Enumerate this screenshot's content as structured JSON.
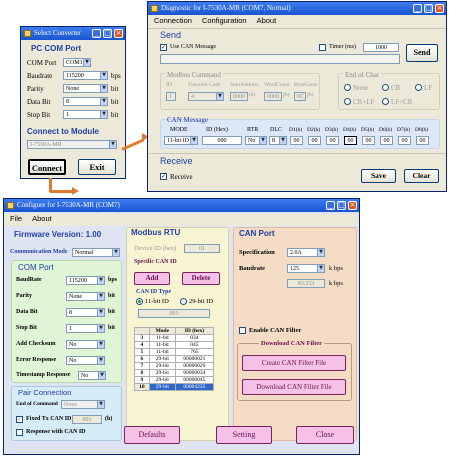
{
  "select": {
    "title": "Select Converter",
    "section1": "PC COM Port",
    "rows": [
      {
        "label": "COM Port",
        "value": "COM1",
        "unit": ""
      },
      {
        "label": "Baudrate",
        "value": "115200",
        "unit": "bps"
      },
      {
        "label": "Parity",
        "value": "None",
        "unit": "bit"
      },
      {
        "label": "Data Bit",
        "value": "8",
        "unit": "bit"
      },
      {
        "label": "Stop Bit",
        "value": "1",
        "unit": "bit"
      }
    ],
    "section2": "Connect to Module",
    "module": "I-7530A-MR",
    "connect": "Connect",
    "exit": "Exit"
  },
  "diag": {
    "title": "Diagnostic for I-7530A-MR (COM7, Normal)",
    "menu": [
      "Connection",
      "Configuration",
      "About"
    ],
    "send_title": "Send",
    "use_can": "Use CAN Message",
    "timer": "Timer (ms)",
    "timer_value": "1000",
    "send_btn": "Send",
    "modbus_title": "Modbus Command",
    "modbus_headers": [
      "ID",
      "Function Code",
      "StartAddress",
      "WordCount",
      "ByteCount"
    ],
    "modbus_values": [
      "1",
      "4",
      "0000",
      "0000",
      "0C"
    ],
    "hex": "(h)",
    "eoc_title": "End of Char",
    "eoc_opts": [
      "None",
      "CR",
      "LF",
      "CR+LF",
      "LF+CR"
    ],
    "canmsg_title": "CAN Message",
    "can_headers": [
      "MODE",
      "ID (Hex)",
      "RTR",
      "DLC",
      "D1(h)",
      "D2(h)",
      "D3(h)",
      "D4(h)",
      "D5(h)",
      "D6(h)",
      "D7(h)",
      "D8(h)"
    ],
    "can_mode": "11-bit ID",
    "can_id": "000",
    "can_rtr": "No",
    "can_dlc": "8",
    "can_data": [
      "00",
      "00",
      "00",
      "00",
      "00",
      "00",
      "00",
      "00"
    ],
    "receive_title": "Receive",
    "receive_chk": "Receive",
    "save": "Save",
    "clear": "Clear"
  },
  "cfg": {
    "title": "Configure for I-7530A-MR (COM7)",
    "menu": [
      "File",
      "About"
    ],
    "fw": "Firmware Version: 1.00",
    "comm_mode_label": "Communication Mode",
    "comm_mode": "Normal",
    "com_title": "COM Port",
    "com_rows": [
      {
        "label": "BaudRate",
        "value": "115200",
        "unit": "bps"
      },
      {
        "label": "Parity",
        "value": "None",
        "unit": "bit"
      },
      {
        "label": "Data Bit",
        "value": "8",
        "unit": "bit"
      },
      {
        "label": "Stop Bit",
        "value": "1",
        "unit": "bit"
      },
      {
        "label": "Add Checksum",
        "value": "No",
        "unit": ""
      },
      {
        "label": "Error Response",
        "value": "No",
        "unit": ""
      },
      {
        "label": "Timestamp Response",
        "value": "No",
        "unit": ""
      }
    ],
    "pair_title": "Pair Connection",
    "eoc_label": "End of Command",
    "eoc_value": "None",
    "fixed_tx": "Fixed Tx CAN ID",
    "fixed_tx_value": "001",
    "hex": "(h)",
    "resp_can": "Response with CAN ID",
    "modbus_title": "Modbus RTU",
    "device_id_label": "Device ID (hex)",
    "device_id": "01",
    "specific_title": "Specific CAN ID",
    "add": "Add",
    "delete": "Delete",
    "canid_type": "CAN ID Type",
    "opt_11": "11-bit ID",
    "opt_29": "29-bit ID",
    "canid_value": "001",
    "tbl_headers": [
      "Mode",
      "ID (hex)"
    ],
    "tbl_rows": [
      {
        "n": "3",
        "mode": "11-bit",
        "id": "034"
      },
      {
        "n": "4",
        "mode": "11-bit",
        "id": "045"
      },
      {
        "n": "5",
        "mode": "11-bit",
        "id": "765"
      },
      {
        "n": "6",
        "mode": "29-bit",
        "id": "00000021"
      },
      {
        "n": "7",
        "mode": "29-bit",
        "id": "00000029"
      },
      {
        "n": "8",
        "mode": "29-bit",
        "id": "00000034"
      },
      {
        "n": "9",
        "mode": "29-bit",
        "id": "00000045"
      },
      {
        "n": "10",
        "mode": "29-bit",
        "id": "00004235"
      }
    ],
    "canport_title": "CAN Port",
    "spec_label": "Specification",
    "spec_value": "2.0A",
    "baud_label": "Baudrate",
    "baud_value": "125",
    "kbps": "k bps",
    "baud_custom": "83.333",
    "enable_filter": "Enable CAN Filter",
    "dl_title": "Download CAN Filter",
    "create_filter": "Create CAN Filter File",
    "download_filter": "Download CAN Filter File",
    "defaults": "Defaults",
    "setting": "Setting",
    "close": "Close"
  },
  "colors": {
    "titlebar": "#2a5fd8",
    "heading": "#1f3fa8",
    "com_bg": "#dff5d6",
    "pair_bg": "#d6ecf7",
    "modbus_bg": "#f7f4d2",
    "canport_bg": "#f5dcc4",
    "pink_btn": "#f5c1e6",
    "arrow": "#e07b30"
  }
}
